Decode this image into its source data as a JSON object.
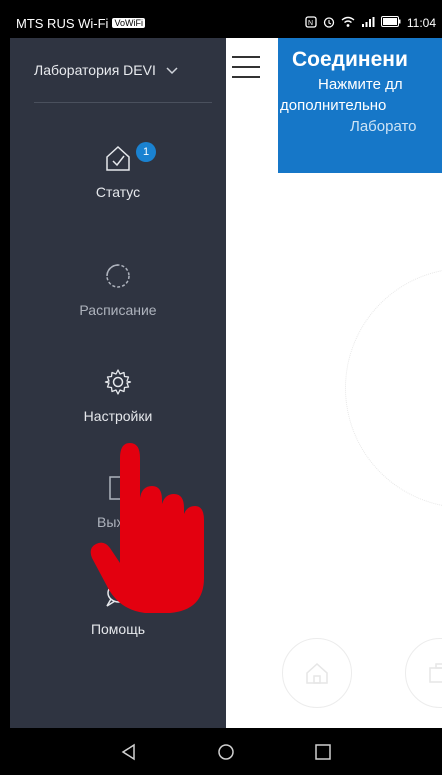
{
  "status_bar": {
    "carrier": "MTS RUS Wi-Fi",
    "carrier_badge": "VoWiFi",
    "time": "11:04"
  },
  "drawer": {
    "location_name": "Лаборатория DEVI",
    "items": [
      {
        "label": "Статус",
        "icon": "home-check-icon",
        "badge": "1"
      },
      {
        "label": "Расписание",
        "icon": "schedule-circle-icon"
      },
      {
        "label": "Настройки",
        "icon": "gear-icon"
      },
      {
        "label": "Выход",
        "icon": "logout-icon"
      },
      {
        "label": "Помощь",
        "icon": "chat-bubble-icon"
      }
    ]
  },
  "banner": {
    "title": "Соединени",
    "line1": "Нажмите дл",
    "line2": "дополнительно",
    "line3": "Лаборато"
  },
  "colors": {
    "drawer_bg": "#2f3441",
    "accent": "#1677c8",
    "badge": "#1a82d1",
    "hand": "#e3000f"
  }
}
